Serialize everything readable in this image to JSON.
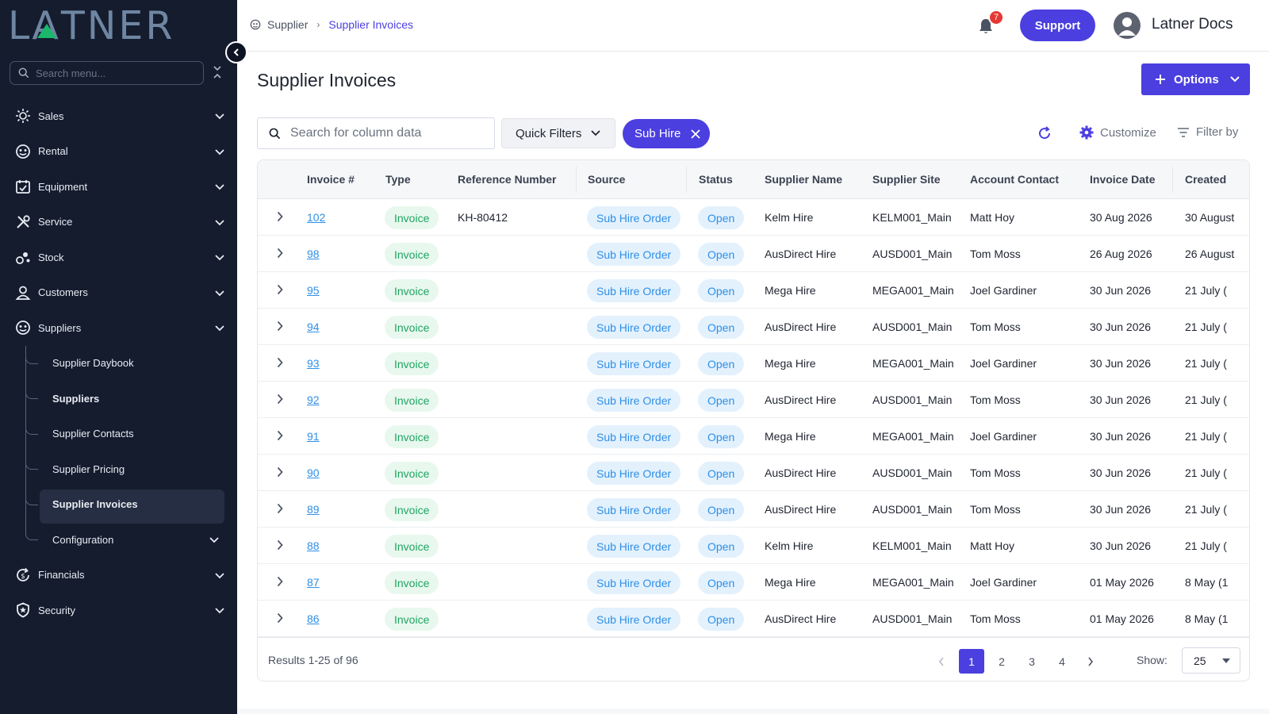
{
  "brand": {
    "logo_text": "LATNER",
    "accent": "#4b3fe0",
    "sidebar_bg": "#141c2e",
    "logo_green": "#19b86a"
  },
  "sidebar": {
    "search_placeholder": "Search menu...",
    "items": [
      {
        "label": "Sales",
        "icon": "sales-icon"
      },
      {
        "label": "Rental",
        "icon": "rental-icon"
      },
      {
        "label": "Equipment",
        "icon": "equipment-icon"
      },
      {
        "label": "Service",
        "icon": "service-icon"
      },
      {
        "label": "Stock",
        "icon": "stock-icon"
      },
      {
        "label": "Customers",
        "icon": "customers-icon"
      },
      {
        "label": "Suppliers",
        "icon": "suppliers-icon"
      }
    ],
    "supplier_sub": [
      {
        "label": "Supplier Daybook"
      },
      {
        "label": "Suppliers"
      },
      {
        "label": "Supplier Contacts"
      },
      {
        "label": "Supplier Pricing"
      },
      {
        "label": "Supplier Invoices"
      },
      {
        "label": "Configuration"
      }
    ],
    "items_after": [
      {
        "label": "Financials",
        "icon": "financials-icon"
      },
      {
        "label": "Security",
        "icon": "security-icon"
      }
    ]
  },
  "header": {
    "breadcrumb": [
      "Supplier",
      "Supplier Invoices"
    ],
    "notification_count": "7",
    "support_label": "Support",
    "user_name": "Latner Docs"
  },
  "main": {
    "title": "Supplier Invoices",
    "options_label": "Options",
    "search_placeholder": "Search for column data",
    "quick_filters_label": "Quick Filters",
    "active_chip": "Sub Hire",
    "customize_label": "Customize",
    "filter_by_label": "Filter by"
  },
  "table": {
    "columns": [
      "Invoice #",
      "Type",
      "Reference Number",
      "Source",
      "Status",
      "Supplier Name",
      "Supplier Site",
      "Account Contact",
      "Invoice Date",
      "Created"
    ],
    "rows": [
      {
        "invoice": "102",
        "type": "Invoice",
        "ref": "KH-80412",
        "source": "Sub Hire Order",
        "status": "Open",
        "supplier": "Kelm Hire",
        "site": "KELM001_Main",
        "contact": "Matt Hoy",
        "date": "30 Aug 2026",
        "created": "30 August"
      },
      {
        "invoice": "98",
        "type": "Invoice",
        "ref": "",
        "source": "Sub Hire Order",
        "status": "Open",
        "supplier": "AusDirect Hire",
        "site": "AUSD001_Main",
        "contact": "Tom Moss",
        "date": "26 Aug 2026",
        "created": "26 August"
      },
      {
        "invoice": "95",
        "type": "Invoice",
        "ref": "",
        "source": "Sub Hire Order",
        "status": "Open",
        "supplier": "Mega Hire",
        "site": "MEGA001_Main",
        "contact": "Joel Gardiner",
        "date": "30 Jun 2026",
        "created": "21 July ("
      },
      {
        "invoice": "94",
        "type": "Invoice",
        "ref": "",
        "source": "Sub Hire Order",
        "status": "Open",
        "supplier": "AusDirect Hire",
        "site": "AUSD001_Main",
        "contact": "Tom Moss",
        "date": "30 Jun 2026",
        "created": "21 July ("
      },
      {
        "invoice": "93",
        "type": "Invoice",
        "ref": "",
        "source": "Sub Hire Order",
        "status": "Open",
        "supplier": "Mega Hire",
        "site": "MEGA001_Main",
        "contact": "Joel Gardiner",
        "date": "30 Jun 2026",
        "created": "21 July ("
      },
      {
        "invoice": "92",
        "type": "Invoice",
        "ref": "",
        "source": "Sub Hire Order",
        "status": "Open",
        "supplier": "AusDirect Hire",
        "site": "AUSD001_Main",
        "contact": "Tom Moss",
        "date": "30 Jun 2026",
        "created": "21 July ("
      },
      {
        "invoice": "91",
        "type": "Invoice",
        "ref": "",
        "source": "Sub Hire Order",
        "status": "Open",
        "supplier": "Mega Hire",
        "site": "MEGA001_Main",
        "contact": "Joel Gardiner",
        "date": "30 Jun 2026",
        "created": "21 July ("
      },
      {
        "invoice": "90",
        "type": "Invoice",
        "ref": "",
        "source": "Sub Hire Order",
        "status": "Open",
        "supplier": "AusDirect Hire",
        "site": "AUSD001_Main",
        "contact": "Tom Moss",
        "date": "30 Jun 2026",
        "created": "21 July ("
      },
      {
        "invoice": "89",
        "type": "Invoice",
        "ref": "",
        "source": "Sub Hire Order",
        "status": "Open",
        "supplier": "AusDirect Hire",
        "site": "AUSD001_Main",
        "contact": "Tom Moss",
        "date": "30 Jun 2026",
        "created": "21 July ("
      },
      {
        "invoice": "88",
        "type": "Invoice",
        "ref": "",
        "source": "Sub Hire Order",
        "status": "Open",
        "supplier": "Kelm Hire",
        "site": "KELM001_Main",
        "contact": "Matt Hoy",
        "date": "30 Jun 2026",
        "created": "21 July ("
      },
      {
        "invoice": "87",
        "type": "Invoice",
        "ref": "",
        "source": "Sub Hire Order",
        "status": "Open",
        "supplier": "Mega Hire",
        "site": "MEGA001_Main",
        "contact": "Joel Gardiner",
        "date": "01 May 2026",
        "created": "8 May (1"
      },
      {
        "invoice": "86",
        "type": "Invoice",
        "ref": "",
        "source": "Sub Hire Order",
        "status": "Open",
        "supplier": "AusDirect Hire",
        "site": "AUSD001_Main",
        "contact": "Tom Moss",
        "date": "01 May 2026",
        "created": "8 May (1"
      }
    ]
  },
  "footer": {
    "results": "Results 1-25 of 96",
    "pages": [
      "1",
      "2",
      "3",
      "4"
    ],
    "current_page": "1",
    "show_label": "Show:",
    "page_size": "25"
  }
}
